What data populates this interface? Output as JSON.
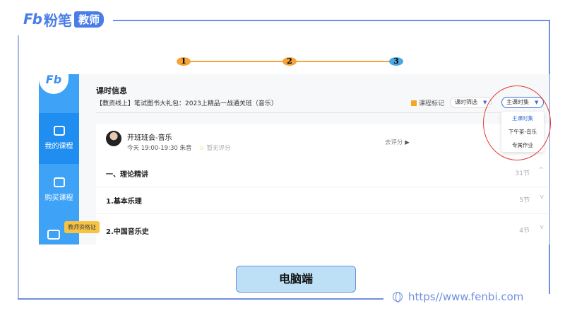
{
  "brand": {
    "logo": "Fb",
    "name": "粉笔",
    "tag": "教师"
  },
  "steps": [
    "1",
    "2",
    "3"
  ],
  "app": {
    "sidebar": [
      {
        "label": "我的课程",
        "active": true
      },
      {
        "label": "购买课程",
        "active": false
      }
    ],
    "tooltip": "教师资格证",
    "title": "课时信息",
    "course": "【教资线上】笔试图书大礼包：2023上精品一战通关班（音乐）",
    "mark": "课程标记",
    "filter": "课时筛选",
    "select": "主课时集",
    "options": [
      "主课时集",
      "下午茶-音乐",
      "专属作业"
    ],
    "lesson": {
      "name": "开班班会-音乐",
      "time": "今天 19:00-19:30",
      "teacher": "朱音",
      "rating": "暂无评分",
      "action": "去评分"
    },
    "sections": [
      {
        "title": "一、理论精讲",
        "count": "31节",
        "chevron": "^"
      },
      {
        "title": "1.基本乐理",
        "count": "5节",
        "chevron": "v"
      },
      {
        "title": "2.中国音乐史",
        "count": "4节",
        "chevron": "v"
      }
    ]
  },
  "label": "电脑端",
  "url": "https//www.fenbi.com"
}
